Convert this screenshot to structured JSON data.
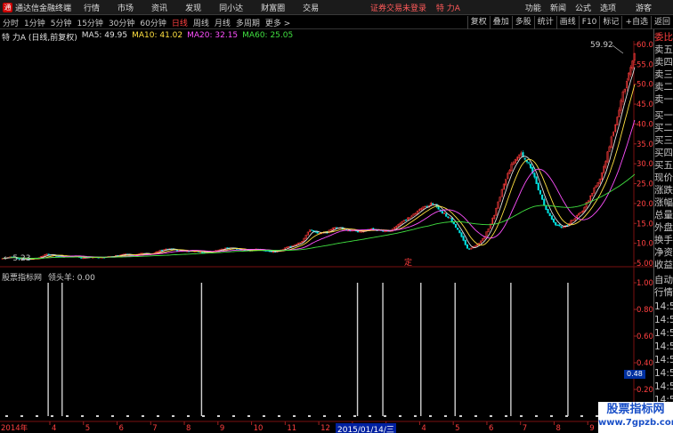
{
  "titlebar": {
    "app_title": "通达信金融终端",
    "menu": [
      "行情",
      "市场",
      "资讯",
      "发现",
      "同小达",
      "财富圈",
      "交易"
    ],
    "status": "证券交易未登录",
    "stock_tag": "特 力A",
    "right_menu": [
      "功能",
      "新闻",
      "公式",
      "选项"
    ],
    "guest": "游客"
  },
  "toolbar": {
    "timeframes": [
      "分时",
      "1分钟",
      "5分钟",
      "15分钟",
      "30分钟",
      "60分钟",
      "日线",
      "周线",
      "月线",
      "多周期",
      "更多 >"
    ],
    "active": "日线",
    "tools": [
      "复权",
      "叠加",
      "多股",
      "统计",
      "画线",
      "F10",
      "标记",
      "+自选",
      "返回"
    ]
  },
  "indicator_line": {
    "title": "特 力A (日线,前复权)",
    "ma5": "MA5: 49.95",
    "ma10": "MA10: 41.02",
    "ma20": "MA20: 32.15",
    "ma60": "MA60: 25.05"
  },
  "price_axis": [
    "60.00",
    "55.00",
    "50.00",
    "45.00",
    "40.00",
    "35.00",
    "30.00",
    "25.00",
    "20.00",
    "15.00",
    "10.00",
    "5.00"
  ],
  "high_label": "59.92",
  "low_label": "← 5.23",
  "marker_label": "定",
  "sub_indicator": {
    "source": "股票指标网",
    "name": "领头羊: 0.00"
  },
  "sub_axis": [
    "1.00",
    "0.80",
    "0.60",
    "0.40",
    "0.20",
    "0.00"
  ],
  "sub_value": "0.48",
  "date_axis": {
    "year": "2014年",
    "months": [
      "4",
      "5",
      "6",
      "7",
      "8",
      "9",
      "10",
      "11",
      "12",
      "1",
      "3",
      "4",
      "5",
      "6",
      "7",
      "8",
      "9"
    ],
    "cross_date": "2015/01/14/三"
  },
  "right_panel": {
    "top_items": [
      "委比",
      "卖五",
      "卖四",
      "卖三",
      "卖二",
      "卖一",
      "买一",
      "买二",
      "买三",
      "买四",
      "买五",
      "现价",
      "涨跌",
      "涨幅",
      "总量",
      "外盘",
      "换手",
      "净资",
      "收益"
    ],
    "bottom_items": [
      "自动",
      "行情",
      "14:50",
      "14:50",
      "14:50",
      "14:50",
      "14:50",
      "14:50",
      "14:50",
      "14:50",
      "14:50"
    ]
  },
  "watermark": {
    "line1": "股票指标网",
    "line2": "www.7gpzb.com"
  },
  "colors": {
    "up": "#ff3c3c",
    "down": "#00e0e0",
    "ma5": "#e0e0e0",
    "ma10": "#ffe040",
    "ma20": "#ff50ff",
    "ma60": "#40e040",
    "signal": "#d0d0d0"
  },
  "chart_data": {
    "type": "candlestick",
    "ylim": [
      5,
      60
    ],
    "ma_values": {
      "MA5": 49.95,
      "MA10": 41.02,
      "MA20": 32.15,
      "MA60": 25.05
    },
    "overview_close": [
      6.2,
      6.6,
      6.1,
      6.0,
      6.3,
      7.2,
      7.0,
      6.6,
      6.8,
      6.3,
      6.5,
      6.4,
      6.6,
      6.9,
      7.4,
      7.0,
      7.5,
      7.3,
      8.2,
      8.6,
      8.1,
      8.0,
      8.1,
      7.6,
      8.0,
      8.6,
      9.0,
      8.4,
      8.1,
      8.5,
      8.1,
      7.8,
      8.6,
      9.4,
      10.2,
      13.5,
      12.6,
      12.8,
      14.2,
      13.4,
      13.2,
      13.0,
      13.6,
      13.2,
      13.0,
      14.6,
      16.0,
      17.5,
      19.2,
      20.0,
      18.0,
      16.2,
      13.0,
      8.5,
      9.4,
      12.0,
      17.0,
      24.0,
      30.0,
      33.0,
      30.0,
      24.0,
      18.0,
      14.5,
      14.0,
      16.0,
      18.0,
      22.0,
      26.0,
      33.0,
      42.0,
      50.0,
      57.0
    ],
    "signal_positions": [
      0.076,
      0.098,
      0.318,
      0.564,
      0.604,
      0.664,
      0.718,
      0.806,
      0.896
    ],
    "signal_value": 1.0
  }
}
